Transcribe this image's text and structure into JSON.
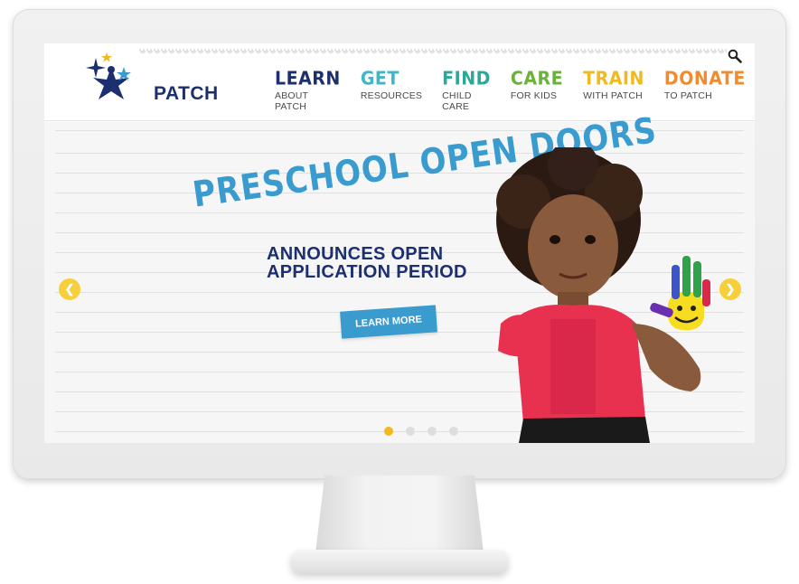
{
  "site": {
    "logo_text": "PATCH",
    "colors": {
      "brand_navy": "#1c2f6e",
      "headline_blue": "#3a9bcf",
      "accent_yellow": "#f2b81d"
    }
  },
  "header": {
    "search_icon": "search-icon",
    "nav": [
      {
        "title": "LEARN",
        "sub": "ABOUT PATCH",
        "color": "#1c2f6e"
      },
      {
        "title": "GET",
        "sub": "RESOURCES",
        "color": "#3fb7c9"
      },
      {
        "title": "FIND",
        "sub": "CHILD CARE",
        "color": "#2aa89a"
      },
      {
        "title": "CARE",
        "sub": "FOR KIDS",
        "color": "#6ab23a"
      },
      {
        "title": "TRAIN",
        "sub": "WITH PATCH",
        "color": "#f2b81d"
      },
      {
        "title": "DONATE",
        "sub": "TO PATCH",
        "color": "#f28a2e"
      }
    ]
  },
  "slide": {
    "headline": "PRESCHOOL OPEN DOORS",
    "subhead": "ANNOUNCES OPEN APPLICATION PERIOD",
    "button_label": "LEARN MORE",
    "prev_icon": "chevron-left-icon",
    "next_icon": "chevron-right-icon",
    "slide_count": 4,
    "active_slide": 1
  }
}
